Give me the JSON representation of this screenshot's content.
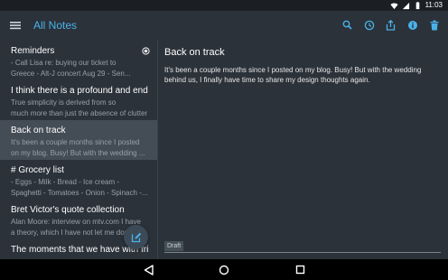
{
  "status_bar": {
    "time": "11:03"
  },
  "app_bar": {
    "title": "All Notes"
  },
  "notes": [
    {
      "title": "Reminders",
      "preview_line1": "- Call Lisa re: buying our ticket to",
      "preview_line2": "Greece - Alt-J concert Aug 29 - Sen..."
    },
    {
      "title": "I think there is a profound and endu...",
      "preview_line1": "True simplicity is derived from so",
      "preview_line2": "much more than just the absence of clutter an..."
    },
    {
      "title": "Back on track",
      "preview_line1": "It's been a couple months since I posted",
      "preview_line2": "on my blog. Busy! But with the wedding ..."
    },
    {
      "title": "# Grocery list",
      "preview_line1": "- Eggs - Milk - Bread - Ice cream -",
      "preview_line2": "Spaghetti - Tomatoes - Onion - Spinach -..."
    },
    {
      "title": "Bret Victor's quote collection",
      "preview_line1": "Alan Moore: interview on mtv.com I have",
      "preview_line2": "a theory, which I have not let me dow..."
    },
    {
      "title": "The moments that we have with frie...",
      "preview_line1": "",
      "preview_line2": ""
    }
  ],
  "editor": {
    "title": "Back on track",
    "body": "It's been a couple months since I posted on my blog. Busy! But with the wedding behind us, I finally have time to share my design thoughts again.",
    "draft_label": "Draft"
  },
  "colors": {
    "accent": "#4ab2e8",
    "background": "#2b323a",
    "selected": "#444c56"
  }
}
